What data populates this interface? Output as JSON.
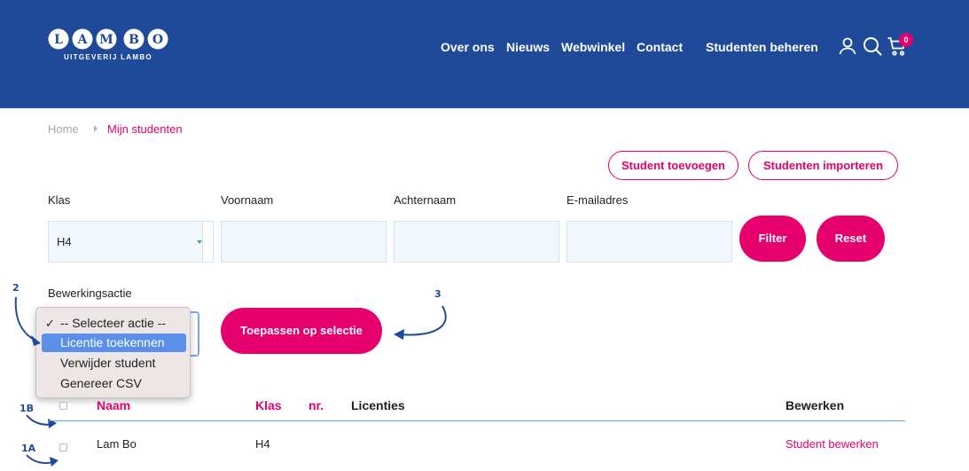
{
  "header": {
    "logo_text": "UITGEVERIJ LAMBO",
    "logo_letters": "LAMBO",
    "nav": [
      "Over ons",
      "Nieuws",
      "Webwinkel",
      "Contact",
      "Studenten beheren"
    ],
    "cart_count": "0",
    "colors": {
      "header_bg": "#1f4a99",
      "accent": "#e5006e"
    }
  },
  "breadcrumb": {
    "home": "Home",
    "current": "Mijn studenten"
  },
  "actions": {
    "add_student": "Student toevoegen",
    "import_students": "Studenten importeren"
  },
  "filters": {
    "klas_label": "Klas",
    "klas_value": "H4",
    "voornaam_label": "Voornaam",
    "achternaam_label": "Achternaam",
    "email_label": "E-mailadres",
    "filter_button": "Filter",
    "reset_button": "Reset"
  },
  "bulk": {
    "label": "Bewerkingsactie",
    "options": [
      "-- Selecteer actie --",
      "Licentie toekennen",
      "Verwijder student",
      "Genereer CSV"
    ],
    "checked_option": "-- Selecteer actie --",
    "highlighted_option": "Licentie toekennen",
    "apply_button": "Toepassen op selectie"
  },
  "annotations": {
    "a2": "2",
    "a3": "3",
    "a1b": "1B",
    "a1a": "1A"
  },
  "table": {
    "headers": {
      "naam": "Naam",
      "klas": "Klas",
      "nr": "nr.",
      "licenties": "Licenties",
      "bewerken": "Bewerken"
    },
    "rows": [
      {
        "naam": "Lam Bo",
        "klas": "H4",
        "nr": "",
        "licenties": "",
        "edit": "Student bewerken"
      }
    ]
  }
}
